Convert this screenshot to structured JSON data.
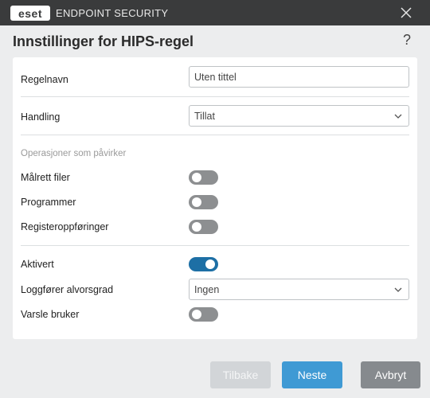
{
  "titlebar": {
    "logo_text": "eset",
    "product_name": "ENDPOINT SECURITY"
  },
  "dialog": {
    "title": "Innstillinger for HIPS-regel",
    "help_label": "?"
  },
  "form": {
    "rule_name": {
      "label": "Regelnavn",
      "value": "Uten tittel"
    },
    "action": {
      "label": "Handling",
      "value": "Tillat"
    },
    "operations_section": "Operasjoner som påvirker",
    "target_files": {
      "label": "Målrett filer",
      "enabled": false
    },
    "applications": {
      "label": "Programmer",
      "enabled": false
    },
    "registry_entries": {
      "label": "Registeroppføringer",
      "enabled": false
    },
    "enabled": {
      "label": "Aktivert",
      "enabled": true
    },
    "log_severity": {
      "label": "Loggfører alvorsgrad",
      "value": "Ingen"
    },
    "notify_user": {
      "label": "Varsle bruker",
      "enabled": false
    }
  },
  "buttons": {
    "back": "Tilbake",
    "next": "Neste",
    "cancel": "Avbryt"
  },
  "colors": {
    "titlebar_bg": "#3a3b3c",
    "accent": "#1d6fa5",
    "next_button": "#3f9ad4",
    "cancel_button": "#868a8e",
    "disabled_button": "#d2d5d8"
  }
}
